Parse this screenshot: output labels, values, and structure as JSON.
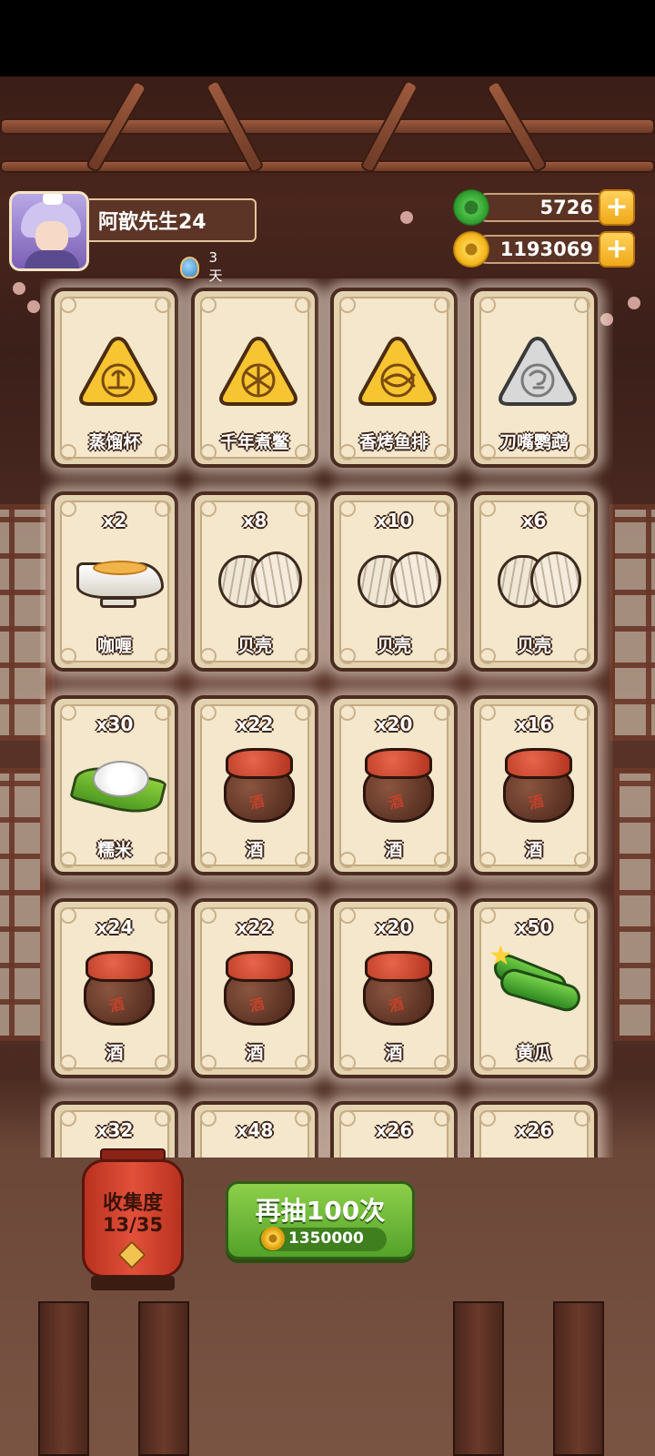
{
  "player": {
    "name": "阿歆先生24",
    "days_label": "3天"
  },
  "currency": {
    "jade": "5726",
    "coins": "1193069",
    "plus": "+"
  },
  "cards": [
    {
      "qty": "",
      "name": "蒸馏杯",
      "icon": "tri-cup"
    },
    {
      "qty": "",
      "name": "千年煮鳖",
      "icon": "tri-turtle"
    },
    {
      "qty": "",
      "name": "香烤鱼排",
      "icon": "tri-fish"
    },
    {
      "qty": "",
      "name": "刀嘴鹦鹉",
      "icon": "tri-gray"
    },
    {
      "qty": "x2",
      "name": "咖喱",
      "icon": "curry"
    },
    {
      "qty": "x8",
      "name": "贝壳",
      "icon": "shell"
    },
    {
      "qty": "x10",
      "name": "贝壳",
      "icon": "shell"
    },
    {
      "qty": "x6",
      "name": "贝壳",
      "icon": "shell"
    },
    {
      "qty": "x30",
      "name": "糯米",
      "icon": "rice"
    },
    {
      "qty": "x22",
      "name": "酒",
      "icon": "wine"
    },
    {
      "qty": "x20",
      "name": "酒",
      "icon": "wine"
    },
    {
      "qty": "x16",
      "name": "酒",
      "icon": "wine"
    },
    {
      "qty": "x24",
      "name": "酒",
      "icon": "wine"
    },
    {
      "qty": "x22",
      "name": "酒",
      "icon": "wine"
    },
    {
      "qty": "x20",
      "name": "酒",
      "icon": "wine"
    },
    {
      "qty": "x50",
      "name": "黄瓜",
      "icon": "cucumber"
    },
    {
      "qty": "x32",
      "name": "",
      "icon": ""
    },
    {
      "qty": "x48",
      "name": "",
      "icon": ""
    },
    {
      "qty": "x26",
      "name": "",
      "icon": ""
    },
    {
      "qty": "x26",
      "name": "",
      "icon": ""
    }
  ],
  "wine_char": "酒",
  "collection": {
    "label": "收集度",
    "count": "13/35"
  },
  "draw_button": {
    "label": "再抽100次",
    "cost": "1350000"
  },
  "colors": {
    "gold": "#f7c531",
    "gray": "#d8d8d8",
    "button_green": "#6fbd36",
    "lantern_red": "#d84632"
  }
}
